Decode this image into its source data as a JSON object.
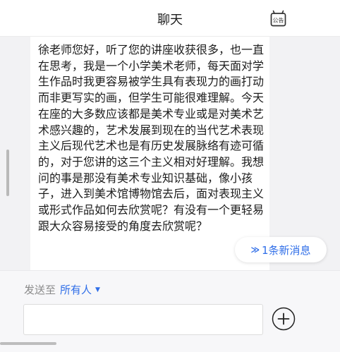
{
  "header": {
    "title": "聊天",
    "notice_icon_label": "公告"
  },
  "chat": {
    "message_text": "徐老师您好，听了您的讲座收获很多，也一直在思考，我是一个小学美术老师，每天面对学生作品时我更容易被学生具有表现力的画打动而非更写实的画，但学生可能很难理解。今天在座的大多数应该都是美术专业或是对美术艺术感兴趣的，艺术发展到现在的当代艺术表现主义后现代艺术也是有历史发展脉络有迹可循的，对于您讲的这三个主义相对好理解。我想问的事是那没有美术专业知识基础，像小孩子，进入到美术馆博物馆去后，面对表现主义或形式作品如何去欣赏呢？有没有一个更轻易跟大众容易接受的角度去欣赏呢？",
    "new_message_chevron": "≫",
    "new_message_label": "1条新消息"
  },
  "compose": {
    "send_to_label": "发送至",
    "recipient": "所有人",
    "recipient_caret": "▼",
    "input_value": "",
    "input_placeholder": ""
  },
  "colors": {
    "accent": "#2f6ee8",
    "header_bg": "#ffffff",
    "chat_bg": "#f2f2f4",
    "compose_bg": "#f7f7f9"
  }
}
